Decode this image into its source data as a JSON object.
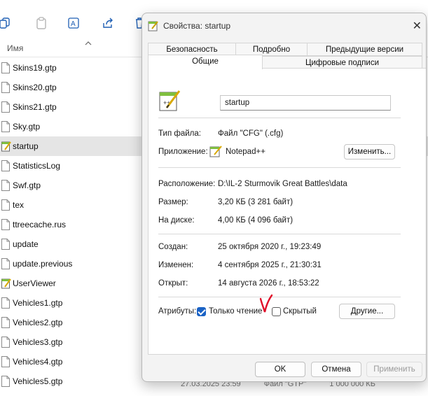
{
  "explorer": {
    "column_name": "Имя",
    "files": [
      {
        "name": "Skins19.gtp",
        "icon": "file-icon"
      },
      {
        "name": "Skins20.gtp",
        "icon": "file-icon"
      },
      {
        "name": "Skins21.gtp",
        "icon": "file-icon"
      },
      {
        "name": "Sky.gtp",
        "icon": "file-icon"
      },
      {
        "name": "startup",
        "icon": "notepadpp-file-icon",
        "selected": true
      },
      {
        "name": "StatisticsLog",
        "icon": "file-icon"
      },
      {
        "name": "Swf.gtp",
        "icon": "file-icon"
      },
      {
        "name": "tex",
        "icon": "file-icon"
      },
      {
        "name": "ttreecache.rus",
        "icon": "file-icon"
      },
      {
        "name": "update",
        "icon": "file-icon"
      },
      {
        "name": "update.previous",
        "icon": "file-icon"
      },
      {
        "name": "UserViewer",
        "icon": "notepadpp-file-icon"
      },
      {
        "name": "Vehicles1.gtp",
        "icon": "file-icon"
      },
      {
        "name": "Vehicles2.gtp",
        "icon": "file-icon"
      },
      {
        "name": "Vehicles3.gtp",
        "icon": "file-icon"
      },
      {
        "name": "Vehicles4.gtp",
        "icon": "file-icon"
      },
      {
        "name": "Vehicles5.gtp",
        "icon": "file-icon"
      }
    ],
    "partial_row": {
      "date": "27.03.2025 23:59",
      "type": "Файл \"GTP\"",
      "size": "1 000 000 КБ"
    }
  },
  "dialog": {
    "title": "Свойства: startup",
    "tabs_back": [
      "Безопасность",
      "Подробно",
      "Предыдущие версии"
    ],
    "tabs_front": [
      "Общие",
      "Цифровые подписи"
    ],
    "active_tab": "Общие",
    "file_name": "startup",
    "labels": {
      "file_type": "Тип файла:",
      "application": "Приложение:",
      "location": "Расположение:",
      "size": "Размер:",
      "size_on_disk": "На диске:",
      "created": "Создан:",
      "modified": "Изменен:",
      "accessed": "Открыт:",
      "attributes": "Атрибуты:"
    },
    "values": {
      "file_type": "Файл \"CFG\" (.cfg)",
      "application": "Notepad++",
      "location": "D:\\IL-2 Sturmovik Great Battles\\data",
      "size": "3,20 КБ (3 281 байт)",
      "size_on_disk": "4,00 КБ (4 096 байт)",
      "created": "25 октября 2020 г., 19:23:49",
      "modified": "4 сентября 2025 г., 21:30:31",
      "accessed": "14 августа 2026 г., 18:53:22"
    },
    "attributes": {
      "readonly_label": "Только чтение",
      "readonly_checked": true,
      "hidden_label": "Скрытый",
      "hidden_checked": false
    },
    "buttons": {
      "change": "Изменить...",
      "other": "Другие...",
      "ok": "OK",
      "cancel": "Отмена",
      "apply": "Применить"
    },
    "colors": {
      "accent": "#1a62c5",
      "annotation": "#e0102a"
    }
  }
}
